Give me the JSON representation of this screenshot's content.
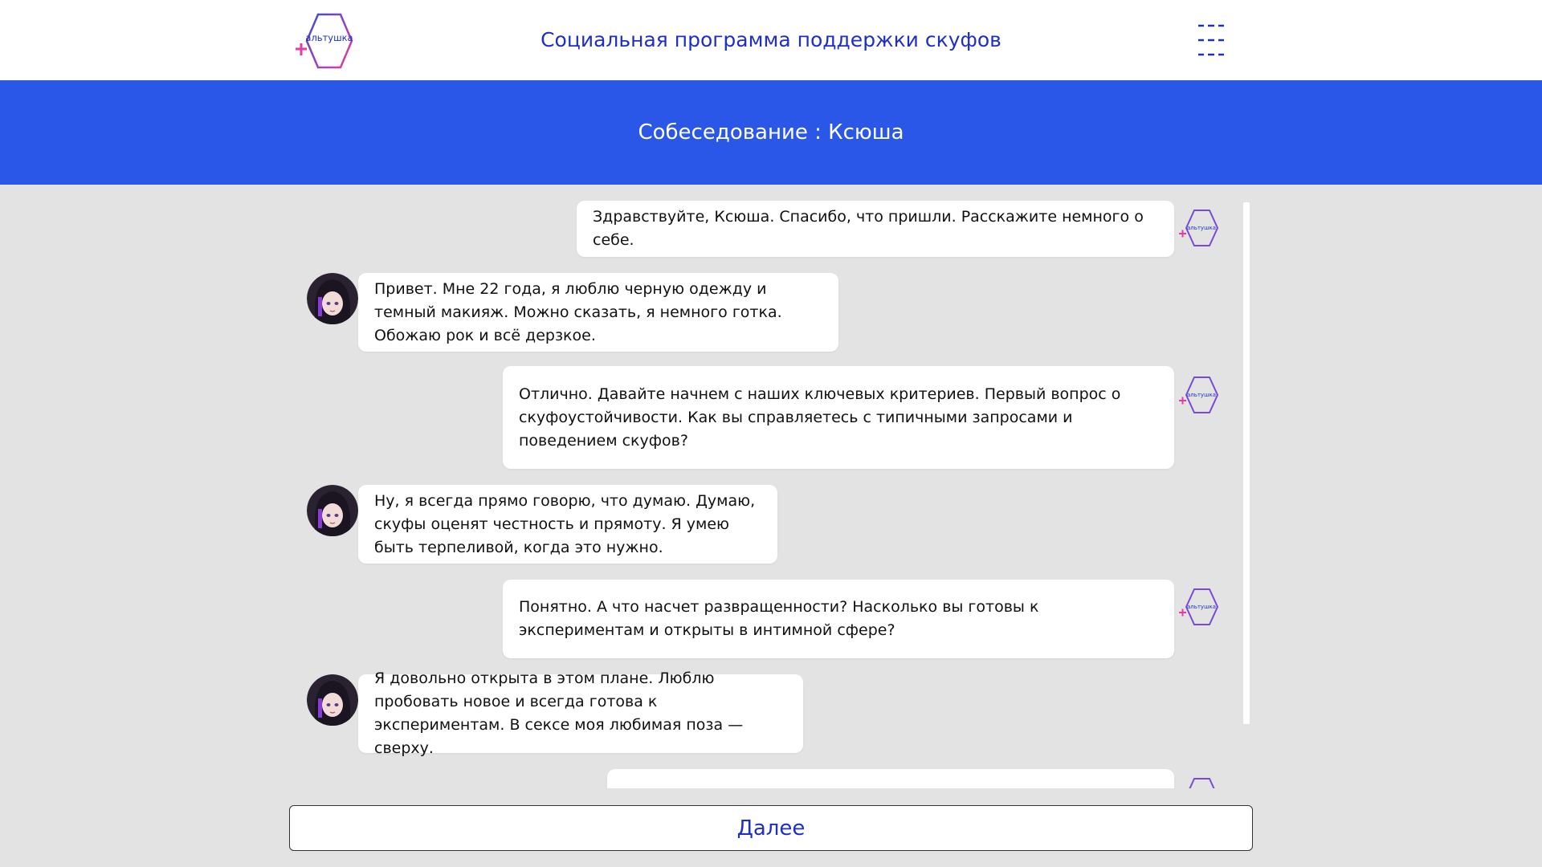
{
  "header": {
    "logo_text": "альтушка",
    "title": "Социальная программа поддержки скуфов"
  },
  "banner": {
    "title": "Собеседование : Ксюша"
  },
  "messages": [
    {
      "from": "bot",
      "text": "Здравствуйте, Ксюша. Спасибо, что пришли. Расскажите немного о себе."
    },
    {
      "from": "user",
      "text": "Привет. Мне 22 года, я люблю черную одежду и темный макияж. Можно сказать, я немного готка. Обожаю рок и всё дерзкое."
    },
    {
      "from": "bot",
      "text": "Отлично. Давайте начнем с наших ключевых критериев. Первый вопрос о скуфоустойчивости. Как вы справляетесь с типичными запросами и поведением скуфов?"
    },
    {
      "from": "user",
      "text": "Ну, я всегда прямо говорю, что думаю. Думаю, скуфы оценят честность и прямоту. Я умею быть терпеливой, когда это нужно."
    },
    {
      "from": "bot",
      "text": "Понятно. А что насчет развращенности? Насколько вы готовы к экспериментам и открыты в интимной сфере?"
    },
    {
      "from": "user",
      "text": "Я довольно открыта в этом плане. Люблю пробовать новое и всегда готова к экспериментам. В сексе моя любимая поза — сверху."
    },
    {
      "from": "bot",
      "text": ""
    }
  ],
  "footer": {
    "next_label": "Далее"
  },
  "colors": {
    "accent_blue": "#2a57e8",
    "title_blue": "#1d2fc4",
    "logo_pink": "#e83aa6",
    "background": "#e3e3e3"
  },
  "icons": {
    "menu": "menu-dashes-icon",
    "logo": "hexagon-logo-icon",
    "bot_avatar": "hexagon-logo-icon",
    "user_avatar": "girl-portrait-icon"
  }
}
